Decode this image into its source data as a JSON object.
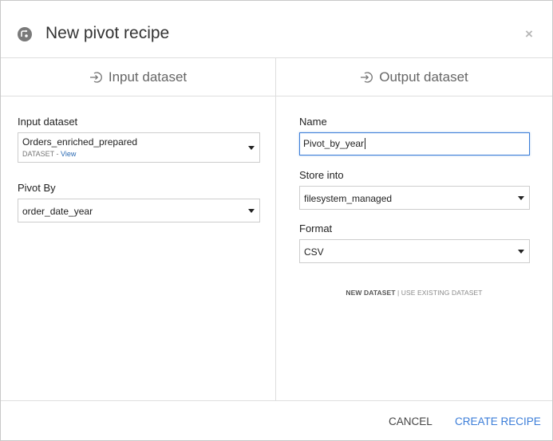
{
  "dialog": {
    "title": "New pivot recipe",
    "close_glyph": "×"
  },
  "input": {
    "header": "Input dataset",
    "dataset_label": "Input dataset",
    "dataset_value": "Orders_enriched_prepared",
    "dataset_type": "DATASET",
    "dataset_sep": " - ",
    "dataset_view_link": "View",
    "pivot_label": "Pivot By",
    "pivot_value": "order_date_year"
  },
  "output": {
    "header": "Output dataset",
    "name_label": "Name",
    "name_value": "Pivot_by_year",
    "store_label": "Store into",
    "store_value": "filesystem_managed",
    "format_label": "Format",
    "format_value": "CSV",
    "mode_new": "NEW DATASET",
    "mode_sep": " | ",
    "mode_existing": "USE EXISTING DATASET"
  },
  "footer": {
    "cancel_label": "CANCEL",
    "create_label": "CREATE RECIPE"
  },
  "icons": {
    "recipe": "pivot-recipe-icon",
    "input": "arrow-in-circle-icon",
    "output": "arrow-in-circle-icon",
    "close": "close-icon",
    "dropdown": "chevron-down-icon"
  },
  "colors": {
    "accent": "#3b7dd8",
    "link": "#2a6ab3",
    "border": "#dedede"
  }
}
